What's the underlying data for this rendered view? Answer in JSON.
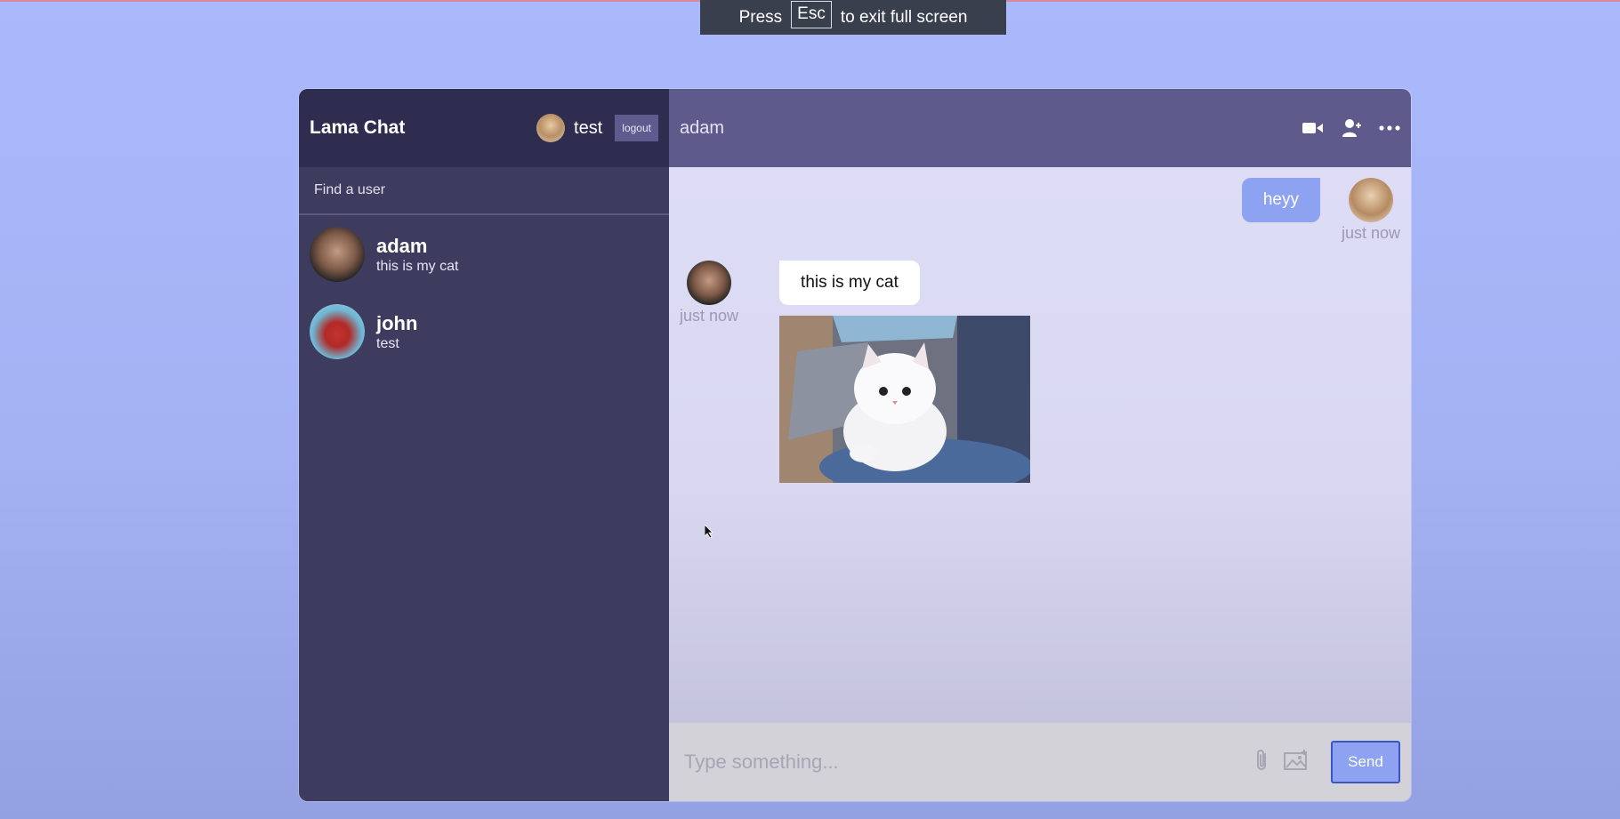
{
  "fullscreen_toast": {
    "press": "Press",
    "key": "Esc",
    "suffix": "to exit full screen"
  },
  "sidebar": {
    "logo": "Lama Chat",
    "current_user": "test",
    "logout_label": "logout",
    "search_placeholder": "Find a user",
    "chats": [
      {
        "name": "adam",
        "last_message": "this is my cat"
      },
      {
        "name": "john",
        "last_message": "test"
      }
    ]
  },
  "chat": {
    "title": "adam",
    "icons": [
      "video-camera-icon",
      "add-user-icon",
      "more-options-icon"
    ],
    "messages": [
      {
        "owner": true,
        "text": "heyy",
        "time": "just now"
      },
      {
        "owner": false,
        "text": "this is my cat",
        "time": "just now",
        "image": "white-kitten-photo"
      }
    ],
    "input_placeholder": "Type something...",
    "send_label": "Send"
  },
  "colors": {
    "sidebar": "#3d3b5e",
    "sidebar_header": "#2f2d4f",
    "chat_header": "#5e5a8c",
    "owner_bubble": "#8da2f0",
    "background": "#a9b9fb"
  }
}
